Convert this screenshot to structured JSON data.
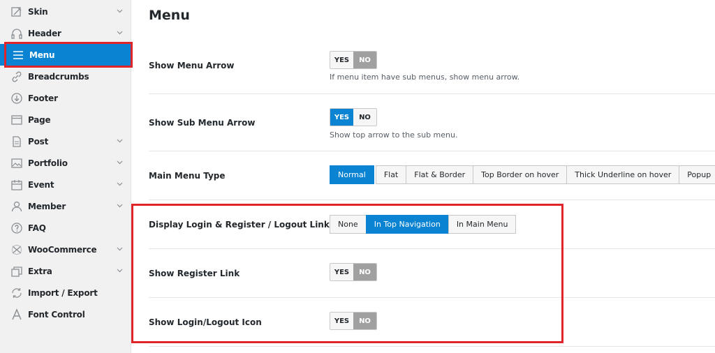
{
  "sidebar": {
    "items": [
      {
        "label": "Skin",
        "icon": "paintbrush-icon",
        "chevron": true
      },
      {
        "label": "Header",
        "icon": "headphones-icon",
        "chevron": true
      },
      {
        "label": "Menu",
        "icon": "hamburger-menu-icon",
        "chevron": false,
        "active": true
      },
      {
        "label": "Breadcrumbs",
        "icon": "link-icon",
        "chevron": false
      },
      {
        "label": "Footer",
        "icon": "arrow-down-circle-icon",
        "chevron": false
      },
      {
        "label": "Page",
        "icon": "browser-window-icon",
        "chevron": false
      },
      {
        "label": "Post",
        "icon": "document-icon",
        "chevron": true
      },
      {
        "label": "Portfolio",
        "icon": "image-icon",
        "chevron": true
      },
      {
        "label": "Event",
        "icon": "calendar-icon",
        "chevron": true
      },
      {
        "label": "Member",
        "icon": "user-icon",
        "chevron": true
      },
      {
        "label": "FAQ",
        "icon": "question-circle-icon",
        "chevron": false
      },
      {
        "label": "WooCommerce",
        "icon": "woocommerce-icon",
        "chevron": true
      },
      {
        "label": "Extra",
        "icon": "layers-icon",
        "chevron": true
      },
      {
        "label": "Import / Export",
        "icon": "refresh-icon",
        "chevron": false
      },
      {
        "label": "Font Control",
        "icon": "font-a-icon",
        "chevron": false
      }
    ]
  },
  "main": {
    "title": "Menu",
    "settings": {
      "show_menu_arrow": {
        "label": "Show Menu Arrow",
        "yes": "YES",
        "no": "NO",
        "value": "NO",
        "description": "If menu item have sub menus, show menu arrow."
      },
      "show_sub_menu_arrow": {
        "label": "Show Sub Menu Arrow",
        "yes": "YES",
        "no": "NO",
        "value": "YES",
        "description": "Show top arrow to the sub menu."
      },
      "main_menu_type": {
        "label": "Main Menu Type",
        "options": [
          "Normal",
          "Flat",
          "Flat & Border",
          "Top Border on hover",
          "Thick Underline on hover",
          "Popup"
        ],
        "value": "Normal"
      },
      "display_login_register": {
        "label": "Display Login & Register / Logout Link",
        "options": [
          "None",
          "In Top Navigation",
          "In Main Menu"
        ],
        "value": "In Top Navigation"
      },
      "show_register_link": {
        "label": "Show Register Link",
        "yes": "YES",
        "no": "NO",
        "value": "NO"
      },
      "show_login_logout_icon": {
        "label": "Show Login/Logout Icon",
        "yes": "YES",
        "no": "NO",
        "value": "NO"
      }
    }
  },
  "colors": {
    "accent": "#0a84d2",
    "highlight": "#e0242b",
    "toggle_off": "#a0a0a0"
  }
}
